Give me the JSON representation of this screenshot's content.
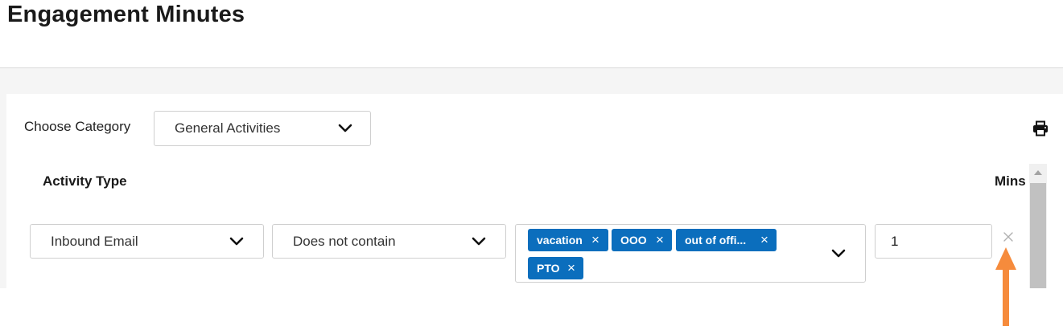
{
  "header": {
    "title": "Engagement Minutes"
  },
  "filters": {
    "category_label": "Choose Category",
    "category_value": "General Activities"
  },
  "toolbar": {
    "print_icon": "print-icon"
  },
  "table": {
    "columns": {
      "activity_type": "Activity Type",
      "mins": "Mins"
    },
    "rows": [
      {
        "activity_type": "Inbound Email",
        "condition": "Does not contain",
        "keywords": [
          "vacation",
          "OOO",
          "out of offi...",
          "PTO"
        ],
        "mins": "1",
        "remove_icon": "close-icon"
      }
    ]
  },
  "colors": {
    "tag_background": "#0b6ebd",
    "annotation_arrow": "#f68b3c",
    "page_background": "#f5f5f5"
  }
}
